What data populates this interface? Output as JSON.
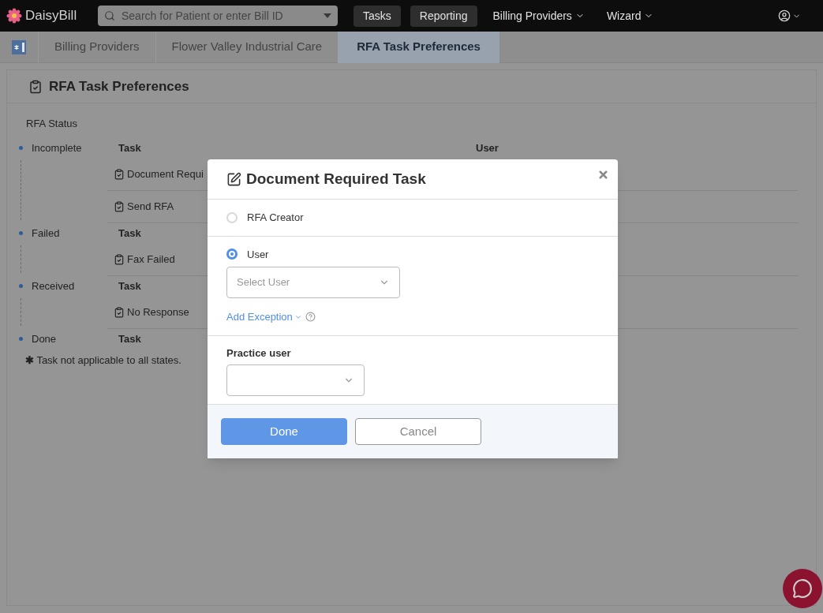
{
  "nav": {
    "brand": "DaisyBill",
    "search": {
      "placeholder": "Search for Patient or enter Bill ID"
    },
    "items": [
      {
        "label": "Tasks",
        "kind": "button"
      },
      {
        "label": "Reporting",
        "kind": "button"
      },
      {
        "label": "Billing Providers",
        "kind": "menu"
      },
      {
        "label": "Wizard",
        "kind": "menu"
      }
    ]
  },
  "breadcrumbs": [
    {
      "label": "Billing Providers",
      "selected": false
    },
    {
      "label": "Flower Valley Industrial Care",
      "selected": false
    },
    {
      "label": "RFA Task Preferences",
      "selected": true
    }
  ],
  "panel": {
    "title": "RFA Task Preferences",
    "status_heading": "RFA Status",
    "groups": [
      {
        "status": "Incomplete",
        "task_heading": "Task",
        "user_heading": "User",
        "tasks": [
          "Document Requi",
          "Send RFA"
        ]
      },
      {
        "status": "Failed",
        "task_heading": "Task",
        "tasks": [
          "Fax Failed"
        ]
      },
      {
        "status": "Received",
        "task_heading": "Task",
        "tasks": [
          "No Response"
        ]
      },
      {
        "status": "Done",
        "task_heading": "Task"
      }
    ],
    "footnote": "**✱** Task not applicable to all states."
  },
  "dialog": {
    "title": "Document Required Task",
    "options": [
      {
        "label": "RFA Creator",
        "selected": false
      },
      {
        "label": "User",
        "selected": true,
        "select": {
          "placeholder": "Select User"
        },
        "link": "Add Exception"
      }
    ],
    "practice_user": {
      "label": "Practice user"
    },
    "buttons": [
      {
        "label": "Done",
        "kind": "primary"
      },
      {
        "label": "Cancel",
        "kind": "secondary"
      }
    ]
  }
}
